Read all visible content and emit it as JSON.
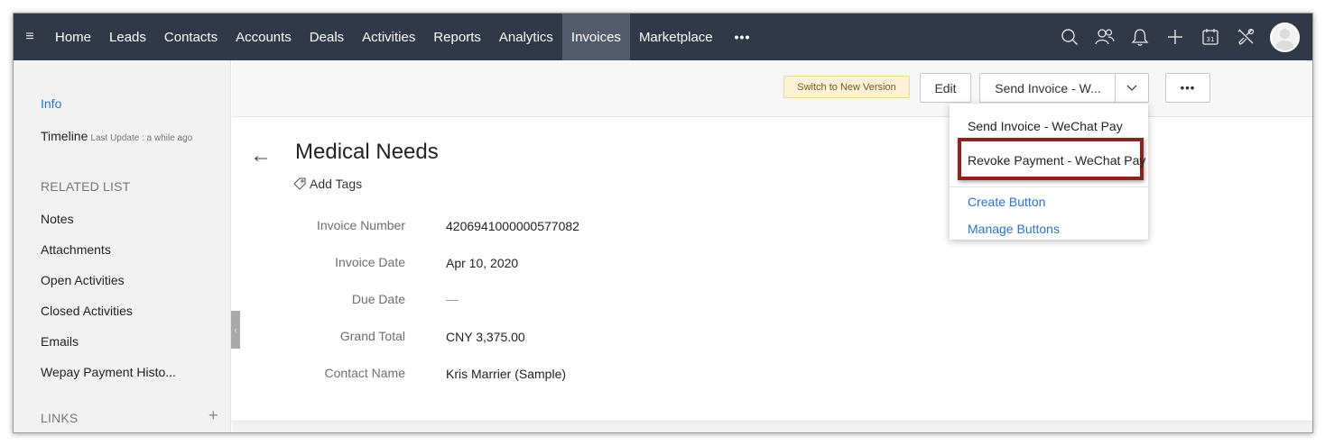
{
  "nav": {
    "tabs": [
      {
        "label": "Home"
      },
      {
        "label": "Leads"
      },
      {
        "label": "Contacts"
      },
      {
        "label": "Accounts"
      },
      {
        "label": "Deals"
      },
      {
        "label": "Activities"
      },
      {
        "label": "Reports"
      },
      {
        "label": "Analytics"
      },
      {
        "label": "Invoices",
        "active": true
      },
      {
        "label": "Marketplace"
      }
    ],
    "more_label": "•••",
    "hamburger_label": "≡",
    "icons": [
      "search-icon",
      "contacts-icon",
      "bell-icon",
      "plus-icon",
      "calendar-icon",
      "settings-tools-icon"
    ],
    "calendar_day": "31"
  },
  "sidebar": {
    "info": "Info",
    "timeline": "Timeline",
    "timeline_update": "Last Update : a while ago",
    "related_heading": "RELATED LIST",
    "related_items": [
      "Notes",
      "Attachments",
      "Open Activities",
      "Closed Activities",
      "Emails",
      "Wepay Payment Histo..."
    ],
    "links_heading": "LINKS",
    "links_add": "+",
    "collapse_glyph": "‹"
  },
  "toolbar": {
    "switch_label": "Switch to New Version",
    "edit_label": "Edit",
    "send_label": "Send Invoice - W...",
    "caret": "⌄",
    "more_label": "•••"
  },
  "record": {
    "back": "←",
    "title": "Medical Needs",
    "add_tags": "Add Tags",
    "fields": [
      {
        "label": "Invoice Number",
        "value": "4206941000000577082"
      },
      {
        "label": "Invoice Date",
        "value": "Apr 10, 2020"
      },
      {
        "label": "Due Date",
        "value": "—"
      },
      {
        "label": "Grand Total",
        "value": "CNY 3,375.00"
      },
      {
        "label": "Contact Name",
        "value": "Kris Marrier (Sample)"
      }
    ]
  },
  "dropdown": {
    "items": [
      "Send Invoice - WeChat Pay",
      "Revoke Payment - WeChat Pay"
    ],
    "create_button": "Create Button",
    "manage_buttons": "Manage Buttons",
    "highlight_color": "#8b2320"
  },
  "colors": {
    "nav_bg": "#313949",
    "nav_active": "#535c6c",
    "link_blue": "#2c73c8"
  }
}
